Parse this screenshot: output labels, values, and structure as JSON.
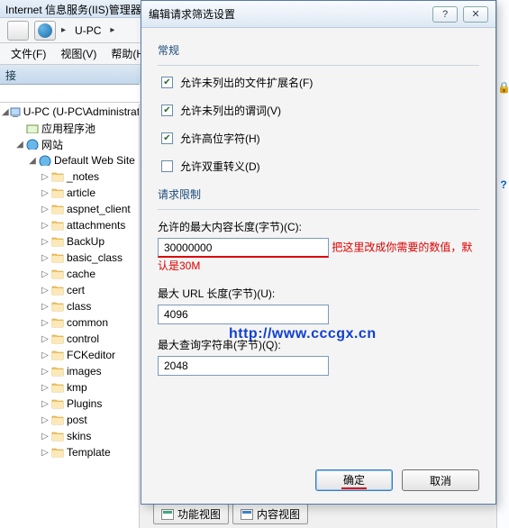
{
  "window": {
    "title": "Internet 信息服务(IIS)管理器",
    "nav_location": "U-PC",
    "nav_arrow": "▸"
  },
  "menu": {
    "file": "文件(F)",
    "view": "视图(V)",
    "help": "帮助(H)"
  },
  "left_panel": {
    "header": "接"
  },
  "tree": {
    "root": "U-PC (U-PC\\Administrator)",
    "app_pools": "应用程序池",
    "sites": "网站",
    "default_site": "Default Web Site",
    "folders": [
      "_notes",
      "article",
      "aspnet_client",
      "attachments",
      "BackUp",
      "basic_class",
      "cache",
      "cert",
      "class",
      "common",
      "control",
      "FCKeditor",
      "images",
      "kmp",
      "Plugins",
      "post",
      "skins",
      "Template"
    ]
  },
  "right_edge": {
    "lock": "🔒",
    "help": "?"
  },
  "bottom_tabs": {
    "features": "功能视图",
    "content": "内容视图"
  },
  "dialog": {
    "title": "编辑请求筛选设置",
    "win_help": "?",
    "win_close": "✕",
    "group_general": "常规",
    "cb_ext": "允许未列出的文件扩展名(F)",
    "cb_verb": "允许未列出的谓词(V)",
    "cb_highbit": "允许高位字符(H)",
    "cb_double": "允许双重转义(D)",
    "group_limits": "请求限制",
    "lbl_maxcontent": "允许的最大内容长度(字节)(C):",
    "val_maxcontent": "30000000",
    "annot_maxcontent": "把这里改成你需要的数值，默认是30M",
    "lbl_maxurl": "最大 URL 长度(字节)(U):",
    "val_maxurl": "4096",
    "lbl_maxquery": "最大查询字符串(字节)(Q):",
    "val_maxquery": "2048",
    "btn_ok": "确定",
    "btn_cancel": "取消"
  },
  "watermark": "http://www.cccgx.cn"
}
